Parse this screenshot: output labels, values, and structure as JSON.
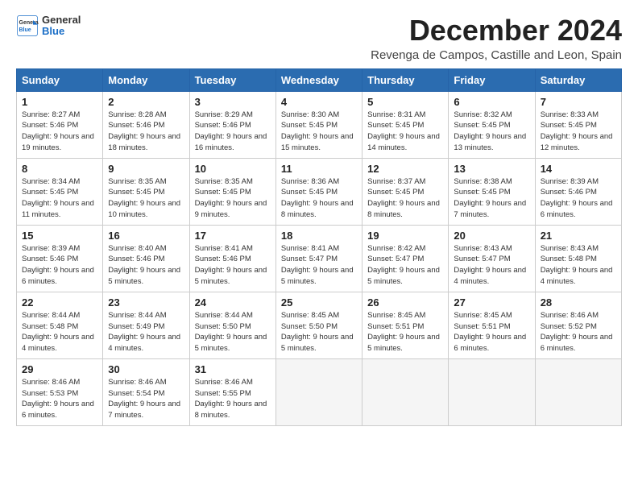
{
  "logo": {
    "general": "General",
    "blue": "Blue"
  },
  "title": "December 2024",
  "subtitle": "Revenga de Campos, Castille and Leon, Spain",
  "headers": [
    "Sunday",
    "Monday",
    "Tuesday",
    "Wednesday",
    "Thursday",
    "Friday",
    "Saturday"
  ],
  "weeks": [
    [
      {
        "day": "1",
        "sunrise": "8:27 AM",
        "sunset": "5:46 PM",
        "daylight": "9 hours and 19 minutes."
      },
      {
        "day": "2",
        "sunrise": "8:28 AM",
        "sunset": "5:46 PM",
        "daylight": "9 hours and 18 minutes."
      },
      {
        "day": "3",
        "sunrise": "8:29 AM",
        "sunset": "5:46 PM",
        "daylight": "9 hours and 16 minutes."
      },
      {
        "day": "4",
        "sunrise": "8:30 AM",
        "sunset": "5:45 PM",
        "daylight": "9 hours and 15 minutes."
      },
      {
        "day": "5",
        "sunrise": "8:31 AM",
        "sunset": "5:45 PM",
        "daylight": "9 hours and 14 minutes."
      },
      {
        "day": "6",
        "sunrise": "8:32 AM",
        "sunset": "5:45 PM",
        "daylight": "9 hours and 13 minutes."
      },
      {
        "day": "7",
        "sunrise": "8:33 AM",
        "sunset": "5:45 PM",
        "daylight": "9 hours and 12 minutes."
      }
    ],
    [
      {
        "day": "8",
        "sunrise": "8:34 AM",
        "sunset": "5:45 PM",
        "daylight": "9 hours and 11 minutes."
      },
      {
        "day": "9",
        "sunrise": "8:35 AM",
        "sunset": "5:45 PM",
        "daylight": "9 hours and 10 minutes."
      },
      {
        "day": "10",
        "sunrise": "8:35 AM",
        "sunset": "5:45 PM",
        "daylight": "9 hours and 9 minutes."
      },
      {
        "day": "11",
        "sunrise": "8:36 AM",
        "sunset": "5:45 PM",
        "daylight": "9 hours and 8 minutes."
      },
      {
        "day": "12",
        "sunrise": "8:37 AM",
        "sunset": "5:45 PM",
        "daylight": "9 hours and 8 minutes."
      },
      {
        "day": "13",
        "sunrise": "8:38 AM",
        "sunset": "5:45 PM",
        "daylight": "9 hours and 7 minutes."
      },
      {
        "day": "14",
        "sunrise": "8:39 AM",
        "sunset": "5:46 PM",
        "daylight": "9 hours and 6 minutes."
      }
    ],
    [
      {
        "day": "15",
        "sunrise": "8:39 AM",
        "sunset": "5:46 PM",
        "daylight": "9 hours and 6 minutes."
      },
      {
        "day": "16",
        "sunrise": "8:40 AM",
        "sunset": "5:46 PM",
        "daylight": "9 hours and 5 minutes."
      },
      {
        "day": "17",
        "sunrise": "8:41 AM",
        "sunset": "5:46 PM",
        "daylight": "9 hours and 5 minutes."
      },
      {
        "day": "18",
        "sunrise": "8:41 AM",
        "sunset": "5:47 PM",
        "daylight": "9 hours and 5 minutes."
      },
      {
        "day": "19",
        "sunrise": "8:42 AM",
        "sunset": "5:47 PM",
        "daylight": "9 hours and 5 minutes."
      },
      {
        "day": "20",
        "sunrise": "8:43 AM",
        "sunset": "5:47 PM",
        "daylight": "9 hours and 4 minutes."
      },
      {
        "day": "21",
        "sunrise": "8:43 AM",
        "sunset": "5:48 PM",
        "daylight": "9 hours and 4 minutes."
      }
    ],
    [
      {
        "day": "22",
        "sunrise": "8:44 AM",
        "sunset": "5:48 PM",
        "daylight": "9 hours and 4 minutes."
      },
      {
        "day": "23",
        "sunrise": "8:44 AM",
        "sunset": "5:49 PM",
        "daylight": "9 hours and 4 minutes."
      },
      {
        "day": "24",
        "sunrise": "8:44 AM",
        "sunset": "5:50 PM",
        "daylight": "9 hours and 5 minutes."
      },
      {
        "day": "25",
        "sunrise": "8:45 AM",
        "sunset": "5:50 PM",
        "daylight": "9 hours and 5 minutes."
      },
      {
        "day": "26",
        "sunrise": "8:45 AM",
        "sunset": "5:51 PM",
        "daylight": "9 hours and 5 minutes."
      },
      {
        "day": "27",
        "sunrise": "8:45 AM",
        "sunset": "5:51 PM",
        "daylight": "9 hours and 6 minutes."
      },
      {
        "day": "28",
        "sunrise": "8:46 AM",
        "sunset": "5:52 PM",
        "daylight": "9 hours and 6 minutes."
      }
    ],
    [
      {
        "day": "29",
        "sunrise": "8:46 AM",
        "sunset": "5:53 PM",
        "daylight": "9 hours and 6 minutes."
      },
      {
        "day": "30",
        "sunrise": "8:46 AM",
        "sunset": "5:54 PM",
        "daylight": "9 hours and 7 minutes."
      },
      {
        "day": "31",
        "sunrise": "8:46 AM",
        "sunset": "5:55 PM",
        "daylight": "9 hours and 8 minutes."
      },
      null,
      null,
      null,
      null
    ]
  ],
  "labels": {
    "sunrise": "Sunrise:",
    "sunset": "Sunset:",
    "daylight": "Daylight:"
  }
}
